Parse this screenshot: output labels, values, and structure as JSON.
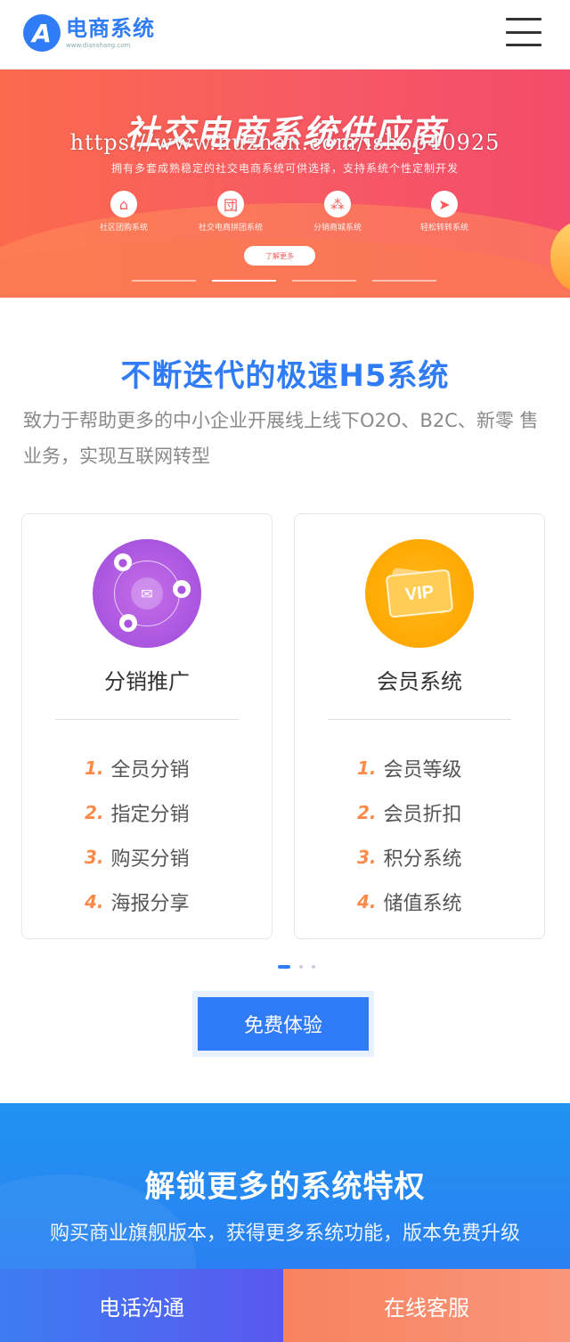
{
  "header": {
    "logo_letter": "A",
    "logo_title": "电商系统",
    "logo_sub": "www.dianshang.com",
    "menu_icon": "hamburger-menu-icon"
  },
  "banner": {
    "title": "社交电商系统供应商",
    "watermark": "https://www.huzhan.com/ishop40925",
    "subtitle": "拥有多套成熟稳定的社交电商系统可供选择，支持系统个性定制开发",
    "features": [
      {
        "label": "社区团购系统",
        "icon": "home-icon"
      },
      {
        "label": "社交电商拼团系统",
        "icon": "group-icon"
      },
      {
        "label": "分销商城系统",
        "icon": "share-network-icon"
      },
      {
        "label": "轻松转转系统",
        "icon": "send-icon"
      }
    ],
    "button_label": "了解更多",
    "slides": 4,
    "active_slide": 2
  },
  "intro": {
    "title": "不断迭代的极速H5系统",
    "description": "致力于帮助更多的中小企业开展线上线下O2O、B2C、新零 售业务，实现互联网转型"
  },
  "cards": [
    {
      "name": "分销推广",
      "icon": "wechat-distribution-icon",
      "items": [
        {
          "num": "1.",
          "text": "全员分销"
        },
        {
          "num": "2.",
          "text": "指定分销"
        },
        {
          "num": "3.",
          "text": "购买分销"
        },
        {
          "num": "4.",
          "text": "海报分享"
        }
      ]
    },
    {
      "name": "会员系统",
      "icon": "vip-card-icon",
      "vip_text": "VIP",
      "items": [
        {
          "num": "1.",
          "text": "会员等级"
        },
        {
          "num": "2.",
          "text": "会员折扣"
        },
        {
          "num": "3.",
          "text": "积分系统"
        },
        {
          "num": "4.",
          "text": "储值系统"
        }
      ]
    }
  ],
  "carousel": {
    "pages": 3,
    "active_page": 1
  },
  "trial_button": "免费体验",
  "promo": {
    "title": "解锁更多的系统特权",
    "description": "购买商业旗舰版本，获得更多系统功能，版本免费升级"
  },
  "footer": {
    "call_label": "电话沟通",
    "chat_label": "在线客服"
  },
  "colors": {
    "brand_blue": "#2f7cf6",
    "accent_orange": "#fe8a4a",
    "banner_red": "#f75a64"
  }
}
